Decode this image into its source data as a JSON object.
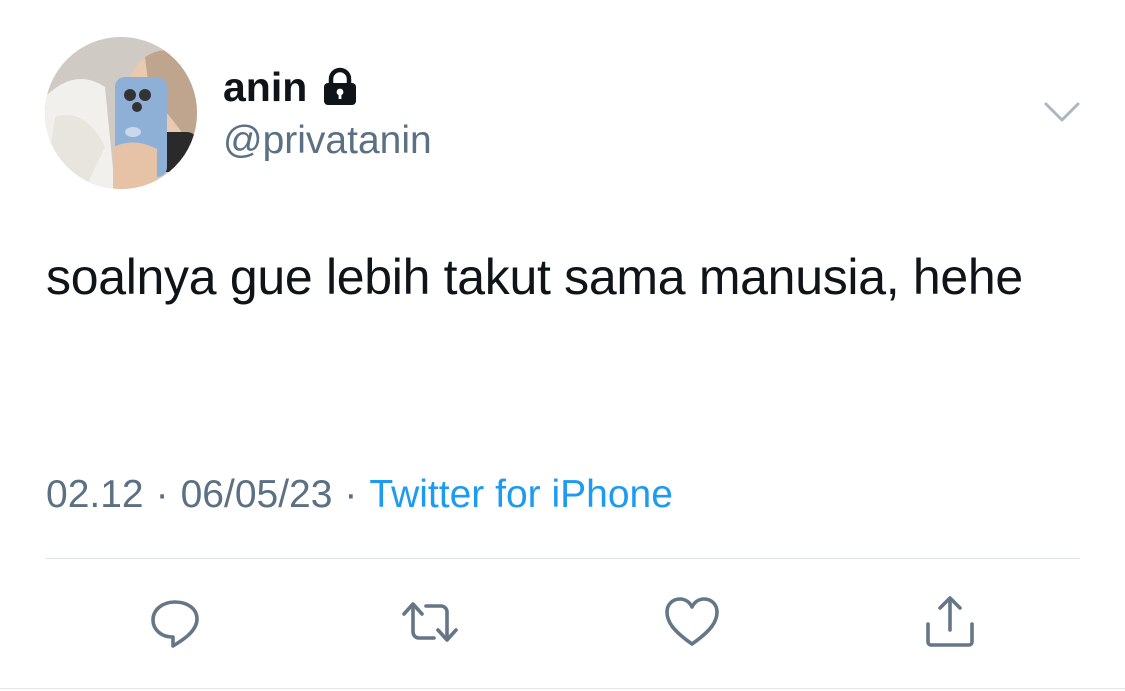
{
  "tweet": {
    "display_name": "anin",
    "handle": "@privatanin",
    "text": "soalnya gue lebih takut sama manusia, hehe",
    "time": "02.12",
    "date": "06/05/23",
    "separator": "·",
    "source": "Twitter for iPhone"
  },
  "icons": {
    "lock": "lock-icon",
    "menu": "chevron-down-icon",
    "reply": "reply-icon",
    "retweet": "retweet-icon",
    "like": "heart-icon",
    "share": "share-icon"
  },
  "colors": {
    "text": "#0f1419",
    "secondary": "#5b7083",
    "link": "#1d9bf0",
    "divider": "#dcdfe3"
  }
}
